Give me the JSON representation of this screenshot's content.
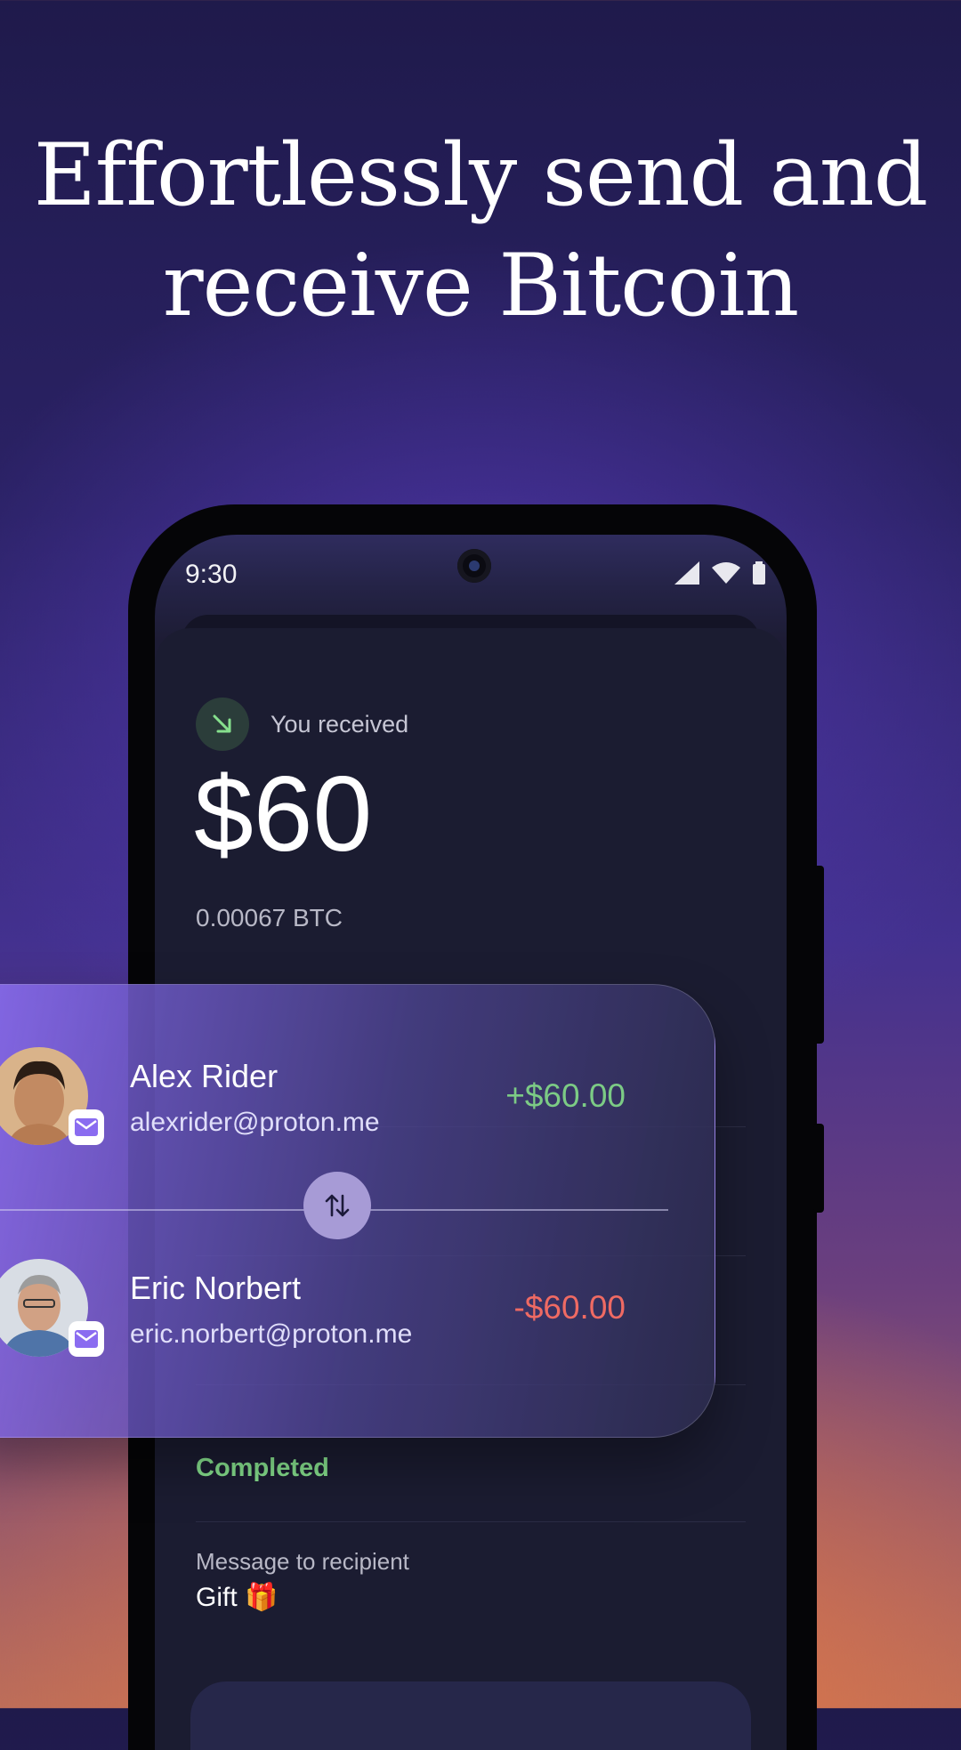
{
  "headline": {
    "line1": "Effortlessly send and",
    "line2": "receive Bitcoin"
  },
  "status_bar": {
    "time": "9:30",
    "icons": [
      "signal-icon",
      "wifi-icon",
      "battery-icon"
    ]
  },
  "transaction": {
    "direction_label": "You received",
    "direction_icon": "arrow-down-right-icon",
    "amount": "$60",
    "btc_amount": "0.00067 BTC",
    "status": "Completed",
    "message_label": "Message to recipient",
    "message_value": "Gift 🎁"
  },
  "transfer_card": {
    "sender": {
      "name": "Alex Rider",
      "email": "alexrider@proton.me",
      "amount": "+$60.00"
    },
    "recipient": {
      "name": "Eric Norbert",
      "email": "eric.norbert@proton.me",
      "amount": "-$60.00"
    },
    "swap_icon": "swap-vertical-icon"
  },
  "colors": {
    "positive": "#7ccb85",
    "negative": "#ef6a63",
    "completed": "#86e08d",
    "sheet": "#1b1c31"
  }
}
